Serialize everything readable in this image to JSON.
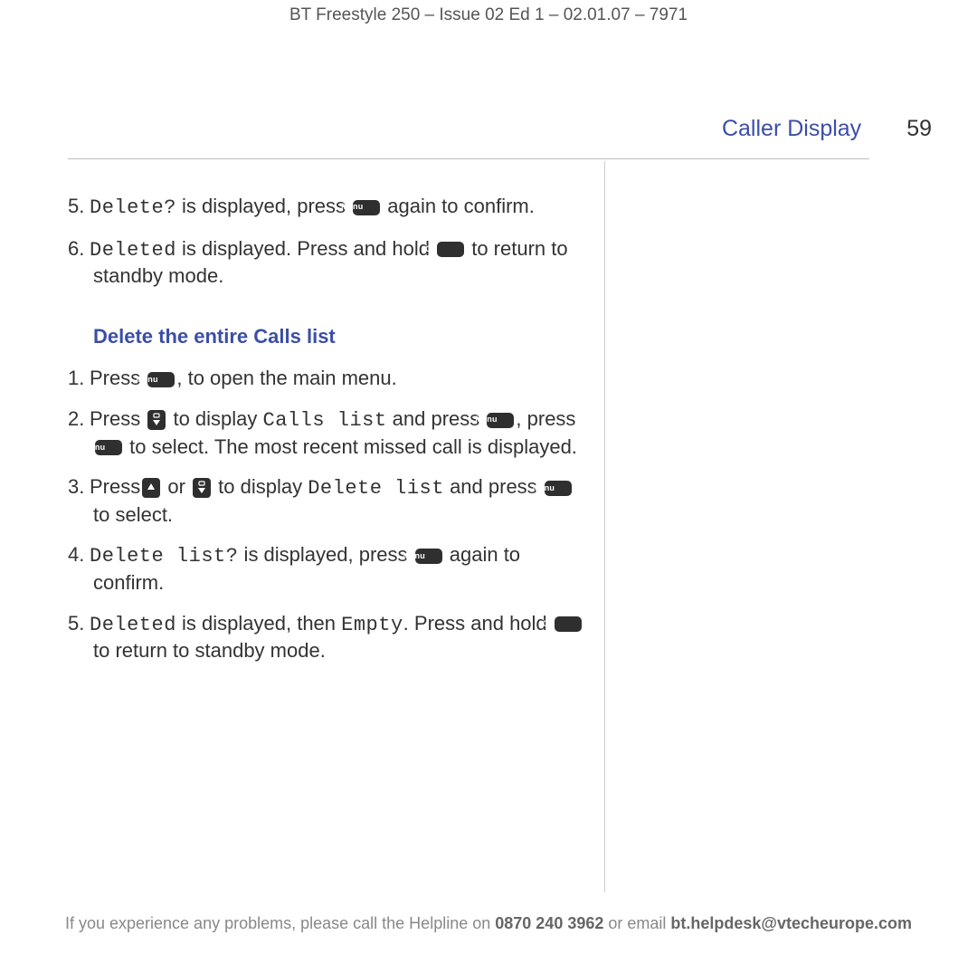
{
  "header": {
    "doc_title": "BT Freestyle 250 – Issue 02 Ed 1 – 02.01.07 – 7971"
  },
  "section": {
    "title": "Caller Display",
    "page": "59"
  },
  "keys": {
    "menu": "Menu",
    "clr": "Clr"
  },
  "top_steps": {
    "s5": {
      "num": "5.",
      "t1": "Delete?",
      "t2": " is displayed, press ",
      "t3": " again to confirm."
    },
    "s6": {
      "num": "6.",
      "t1": "Deleted",
      "t2": " is displayed. Press and hold ",
      "t3": " to return to standby mode."
    }
  },
  "heading": "Delete the entire Calls list",
  "steps": {
    "s1": {
      "num": "1.",
      "t1": "Press ",
      "t2": ", to open the main menu."
    },
    "s2": {
      "num": "2.",
      "t1": "Press ",
      "t2": " to display ",
      "term1": "Calls list",
      "t3": " and press ",
      "t4": ", press ",
      "t5": " to select. The most recent missed call is displayed."
    },
    "s3": {
      "num": "3.",
      "t1": "Press",
      "t2": " or ",
      "t3": " to display ",
      "term1": "Delete list",
      "t4": " and press ",
      "t5": " to select."
    },
    "s4": {
      "num": "4.",
      "term1": "Delete list?",
      "t1": " is displayed, press ",
      "t2": " again to confirm."
    },
    "s5": {
      "num": "5.",
      "term1": "Deleted",
      "t1": " is displayed, then ",
      "term2": "Empty",
      "t2": ". Press and hold ",
      "t3": " to return to standby mode."
    }
  },
  "footer": {
    "pre": "If you experience any problems, please call the Helpline on ",
    "phone": "0870 240 3962",
    "mid": " or email ",
    "email": "bt.helpdesk@vtecheurope.com"
  }
}
